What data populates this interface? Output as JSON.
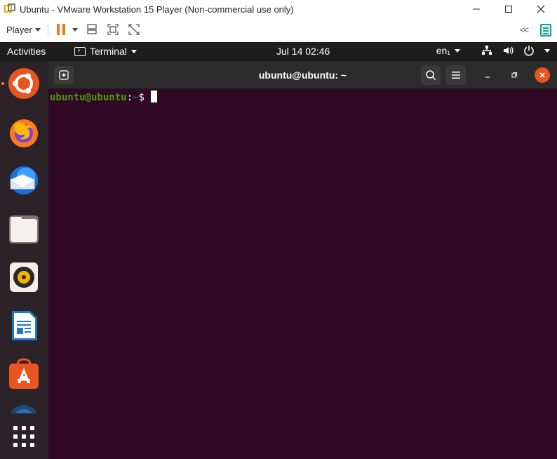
{
  "vmware": {
    "title": "Ubuntu - VMware Workstation 15 Player (Non-commercial use only)",
    "player_menu_label": "Player",
    "window_buttons": {
      "minimize": "—",
      "maximize": "☐",
      "close": "✕"
    },
    "collapse_label": "<<",
    "colors": {
      "pause": "#f07a1a",
      "note": "#17a08c"
    }
  },
  "ubuntu": {
    "activities_label": "Activities",
    "app_menu_label": "Terminal",
    "clock": "Jul 14  02:46",
    "input_language": "en₁",
    "dock": [
      {
        "name": "Ubuntu",
        "icon": "ubuntu-logo-icon"
      },
      {
        "name": "Firefox",
        "icon": "firefox-icon"
      },
      {
        "name": "Thunderbird",
        "icon": "thunderbird-icon"
      },
      {
        "name": "Files",
        "icon": "files-icon"
      },
      {
        "name": "Rhythmbox",
        "icon": "rhythmbox-icon"
      },
      {
        "name": "LibreOffice Writer",
        "icon": "writer-icon"
      },
      {
        "name": "Ubuntu Software",
        "icon": "software-icon"
      },
      {
        "name": "Help",
        "icon": "help-icon"
      },
      {
        "name": "Show Applications",
        "icon": "app-grid-icon"
      }
    ],
    "colors": {
      "accent": "#e95420",
      "terminal_bg": "#300a24",
      "dock_bg": "#2b2328"
    }
  },
  "terminal": {
    "title": "ubuntu@ubuntu: ~",
    "prompt": {
      "user_host": "ubuntu@ubuntu",
      "separator": ":",
      "path": "~",
      "symbol": "$"
    }
  }
}
